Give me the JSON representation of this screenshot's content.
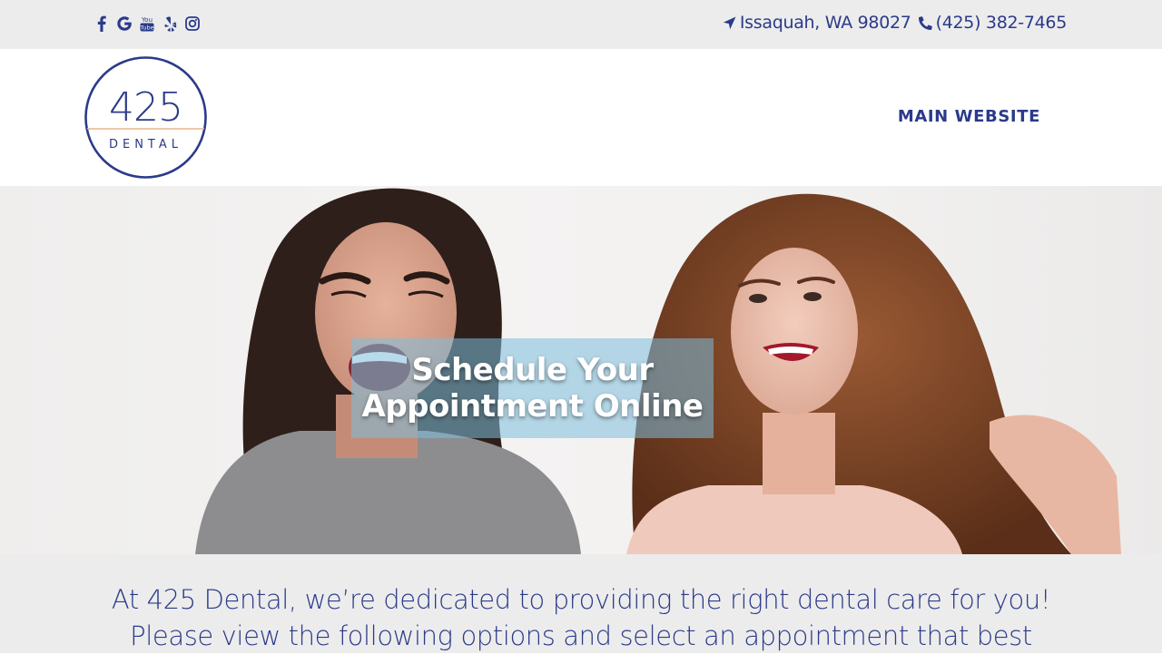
{
  "colors": {
    "brand": "#2b3a8a",
    "topbar_bg": "#ececec",
    "hero_overlay": "#7dbedc",
    "logo_accent": "#e8b58c"
  },
  "topbar": {
    "social_icons": [
      "facebook-icon",
      "google-icon",
      "youtube-icon",
      "yelp-icon",
      "instagram-icon"
    ],
    "location": "Issaquah, WA 98027",
    "phone": "(425) 382-7465"
  },
  "header": {
    "logo": {
      "number": "425",
      "word": "DENTAL"
    },
    "nav": {
      "main_website": "MAIN WEBSITE"
    }
  },
  "hero": {
    "title_line1": "Schedule Your",
    "title_line2": "Appointment Online"
  },
  "intro": {
    "line1": "At 425 Dental, we’re dedicated to providing the right dental care for you!",
    "line2": "Please view the following options and select an appointment that best"
  }
}
